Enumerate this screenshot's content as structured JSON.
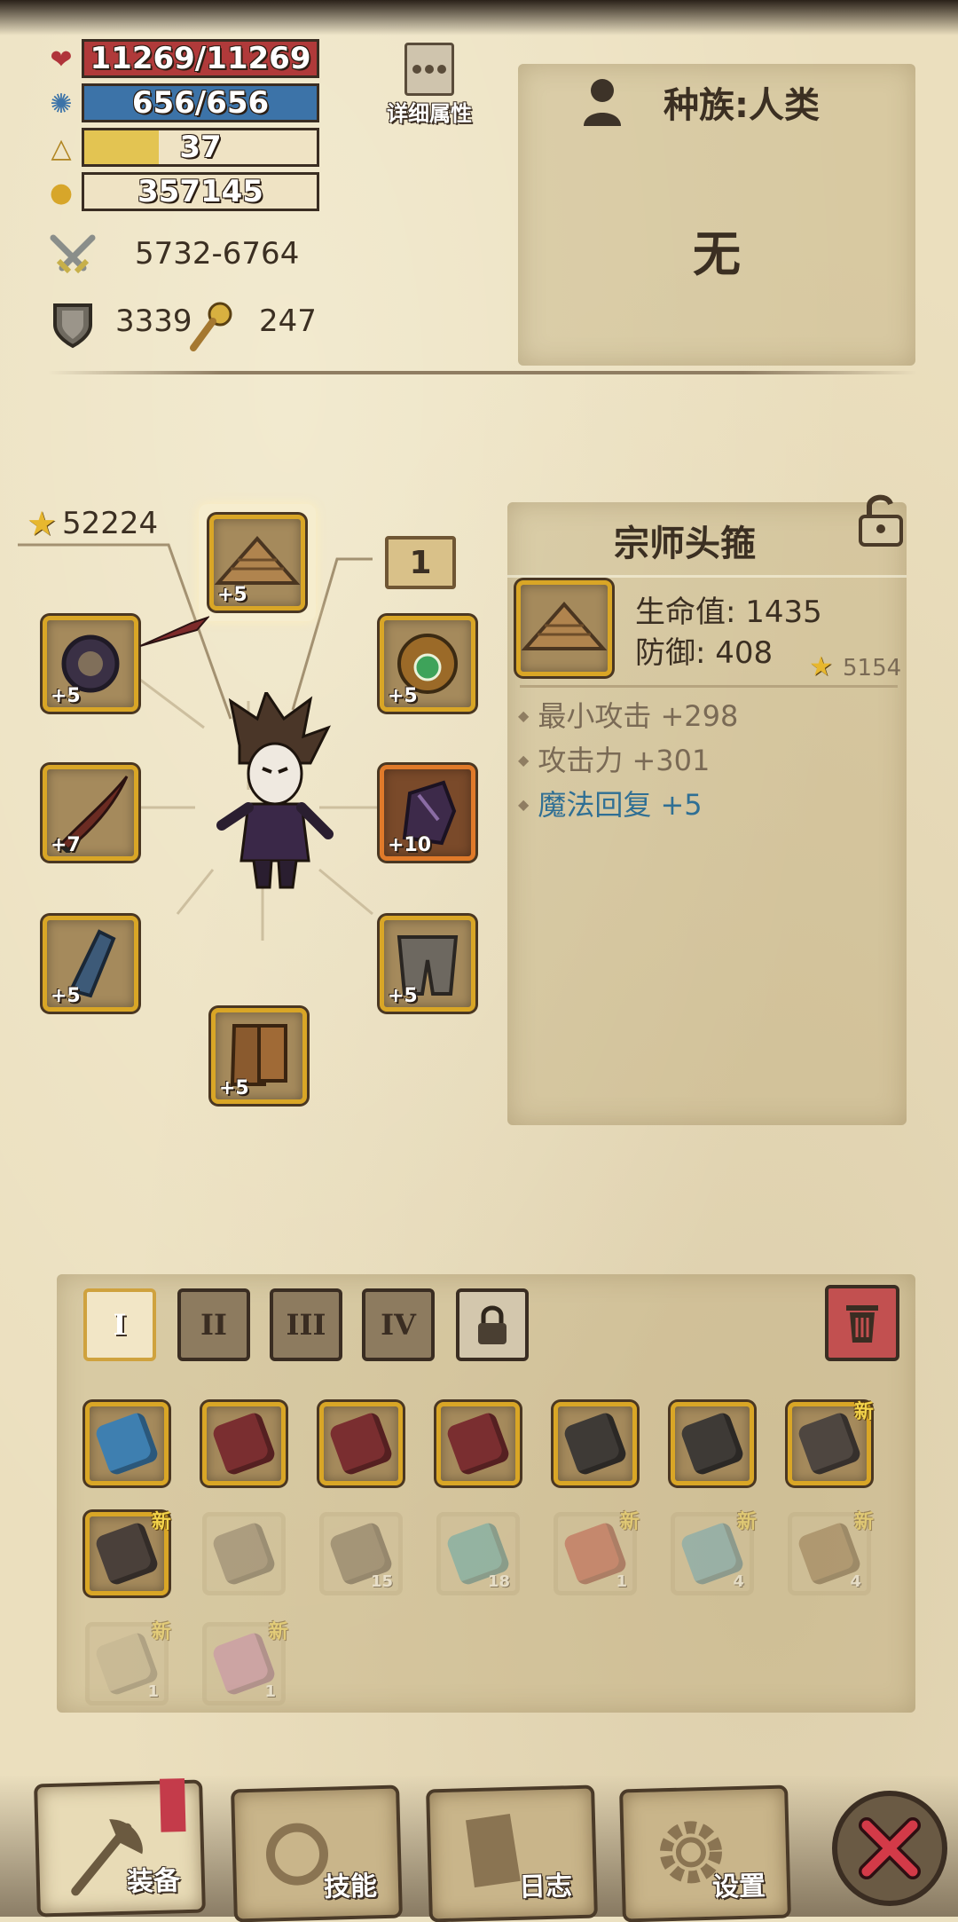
{
  "stats": {
    "hp": "11269/11269",
    "mana": "656/656",
    "level": "37",
    "gold": "357145",
    "attack_range": "5732-6764",
    "defense": "3339",
    "magic": "247",
    "level_progress": 0.32
  },
  "detail_button_label": "详细属性",
  "race": {
    "label": "种族:人类",
    "value": "无"
  },
  "power": "52224",
  "slot_count": "1",
  "equip_slots": [
    {
      "icon": "straw-hat-icon",
      "level": "+5"
    },
    {
      "icon": "spiked-bracer-icon",
      "level": "+5"
    },
    {
      "icon": "gem-amulet-icon",
      "level": "+5"
    },
    {
      "icon": "curved-sword-icon",
      "level": "+7"
    },
    {
      "icon": "dark-gauntlet-icon",
      "level": "+10"
    },
    {
      "icon": "blue-boot-icon",
      "level": "+5"
    },
    {
      "icon": "iron-greaves-icon",
      "level": "+5"
    },
    {
      "icon": "leather-boots-icon",
      "level": "+5"
    }
  ],
  "item_detail": {
    "name": "宗师头箍",
    "hp": "生命值: 1435",
    "defense": "防御: 408",
    "score": "5154",
    "bonuses": [
      {
        "text": "最小攻击 +298",
        "color": "#7a6a55"
      },
      {
        "text": "攻击力 +301",
        "color": "#7a6a55"
      },
      {
        "text": "魔法回复 +5",
        "color": "#2f6f94"
      }
    ]
  },
  "inventory_tabs": [
    "I",
    "II",
    "III",
    "IV"
  ],
  "inventory": [
    {
      "icon": "blue-sword-icon",
      "count": "",
      "new": false,
      "dim": false
    },
    {
      "icon": "battle-axe-icon",
      "count": "",
      "new": false,
      "dim": false
    },
    {
      "icon": "battle-axe-icon",
      "count": "",
      "new": false,
      "dim": false
    },
    {
      "icon": "battle-axe-icon",
      "count": "",
      "new": false,
      "dim": false
    },
    {
      "icon": "iron-helmet-icon",
      "count": "",
      "new": false,
      "dim": false
    },
    {
      "icon": "iron-helmet-icon",
      "count": "",
      "new": false,
      "dim": false
    },
    {
      "icon": "iron-boots-icon",
      "count": "",
      "new": true,
      "dim": false
    },
    {
      "icon": "iron-bracer-icon",
      "count": "",
      "new": true,
      "dim": false
    },
    {
      "icon": "stone-pile-icon",
      "count": "",
      "new": false,
      "dim": true
    },
    {
      "icon": "pickaxe-icon",
      "count": "15",
      "new": false,
      "dim": true
    },
    {
      "icon": "eye-scroll-icon",
      "count": "18",
      "new": false,
      "dim": true
    },
    {
      "icon": "red-potion-icon",
      "count": "1",
      "new": true,
      "dim": true
    },
    {
      "icon": "blue-potion-icon",
      "count": "4",
      "new": true,
      "dim": true
    },
    {
      "icon": "treasure-chest-icon",
      "count": "4",
      "new": true,
      "dim": true
    },
    {
      "icon": "map-scroll-icon",
      "count": "1",
      "new": true,
      "dim": true
    },
    {
      "icon": "pink-potion-icon",
      "count": "1",
      "new": true,
      "dim": true
    }
  ],
  "new_label": "新",
  "nav": {
    "equip": "装备",
    "skills": "技能",
    "log": "日志",
    "settings": "设置"
  },
  "colors": {
    "hp_bar": "#b03a3a",
    "mana_bar": "#3c73a8",
    "level_bar": "#e3c452",
    "frame_gold": "#d9a626"
  }
}
